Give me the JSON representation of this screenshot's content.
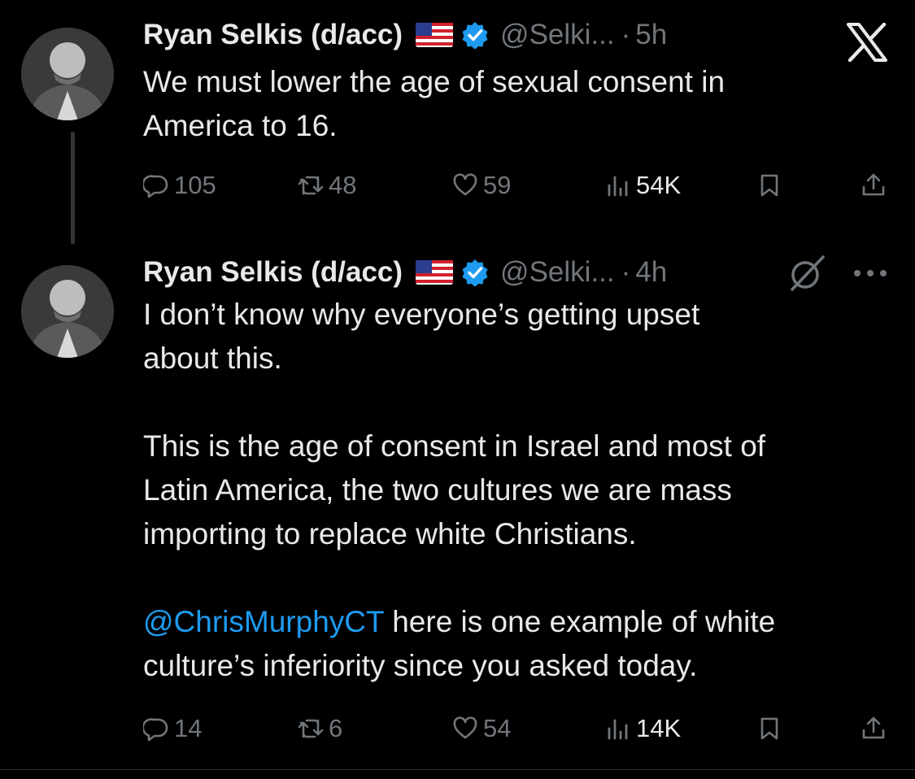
{
  "tweets": [
    {
      "display_name": "Ryan Selkis (d/acc)",
      "flag_icon": "us-flag-icon",
      "verified_icon": "verified-badge-icon",
      "handle": "@Selki...",
      "separator": "·",
      "time": "5h",
      "text": "We must lower the age of sexual consent in\nAmerica to 16.",
      "stats": {
        "replies": "105",
        "retweets": "48",
        "likes": "59",
        "views": "54K"
      }
    },
    {
      "display_name": "Ryan Selkis (d/acc)",
      "flag_icon": "us-flag-icon",
      "verified_icon": "verified-badge-icon",
      "handle": "@Selki...",
      "separator": "·",
      "time": "4h",
      "text_part1": "I don’t know why everyone’s getting upset\nabout this.\n\nThis is the age of consent in Israel and most of\nLatin America, the two cultures we are mass\nimporting to replace white Christians.\n\n",
      "mention": "@ChrisMurphyCT",
      "text_part2": " here is one example of white\nculture’s inferiority since you asked today.",
      "stats": {
        "replies": "14",
        "retweets": "6",
        "likes": "54",
        "views": "14K"
      }
    }
  ],
  "icons": {
    "app_logo": "x-logo-icon",
    "grok": "grok-icon",
    "more": "more-options-icon"
  },
  "colors": {
    "background": "#000000",
    "text": "#e7e9ea",
    "muted": "#71767b",
    "mention": "#1d9bf0",
    "verified": "#1d9bf0"
  }
}
